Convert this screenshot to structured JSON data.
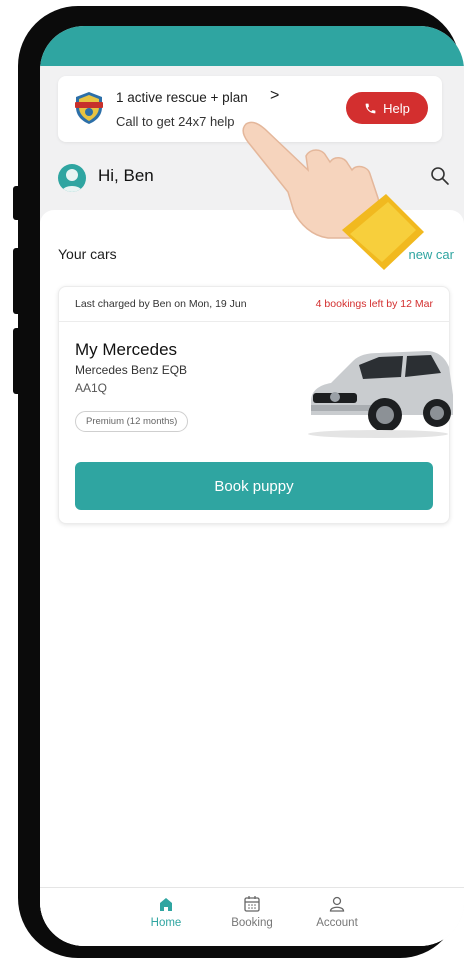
{
  "rescue_banner": {
    "title": "1 active rescue + plan",
    "chevron": ">",
    "subtitle": "Call to get 24x7 help",
    "help_label": "Help"
  },
  "greeting": {
    "text": "Hi, Ben"
  },
  "cars_section": {
    "title": "Your cars",
    "add_label": "new car"
  },
  "car_card": {
    "last_charged": "Last charged by Ben on Mon, 19 Jun",
    "bookings_left": "4 bookings left by 12 Mar",
    "name": "My Mercedes",
    "model": "Mercedes Benz EQB",
    "plate": "AA1Q",
    "plan": "Premium (12 months)",
    "book_label": "Book puppy"
  },
  "bottom_nav": {
    "items": [
      {
        "label": "Home",
        "icon": "home-icon",
        "active": true
      },
      {
        "label": "Booking",
        "icon": "calendar-icon",
        "active": false
      },
      {
        "label": "Account",
        "icon": "user-icon",
        "active": false
      }
    ]
  },
  "colors": {
    "accent": "#2fa5a1",
    "danger": "#d32f2f",
    "frame": "#0b0b0b"
  }
}
